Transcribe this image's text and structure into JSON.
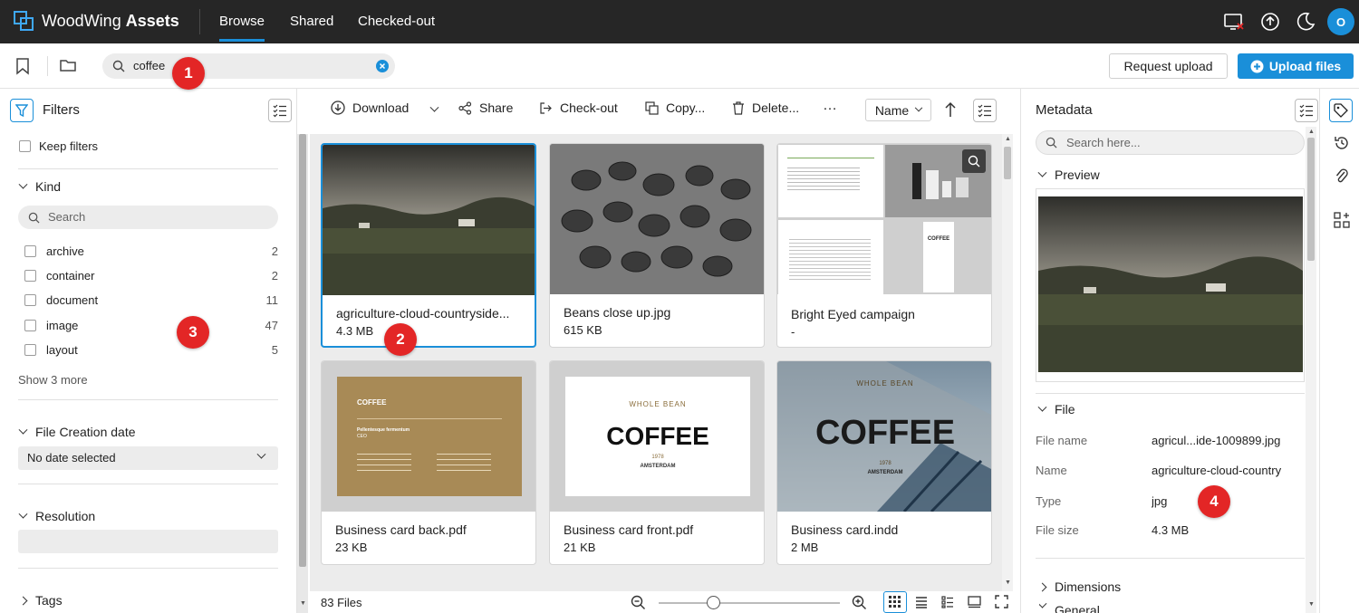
{
  "app": {
    "logo_text": "WoodWing",
    "logo_bold": "Assets",
    "avatar_initial": "O"
  },
  "nav": {
    "tabs": [
      "Browse",
      "Shared",
      "Checked-out"
    ],
    "active_tab": "Browse"
  },
  "toolbar": {
    "search_query": "coffee",
    "request_upload": "Request upload",
    "upload_files": "Upload files"
  },
  "filters": {
    "title": "Filters",
    "keep_filters": "Keep filters",
    "kind": {
      "title": "Kind",
      "search_placeholder": "Search",
      "items": [
        {
          "label": "archive",
          "count": "2"
        },
        {
          "label": "container",
          "count": "2"
        },
        {
          "label": "document",
          "count": "11"
        },
        {
          "label": "image",
          "count": "47"
        },
        {
          "label": "layout",
          "count": "5"
        }
      ],
      "show_more": "Show 3 more"
    },
    "file_creation_date": {
      "title": "File Creation date",
      "value": "No date selected"
    },
    "resolution": {
      "title": "Resolution"
    },
    "tags": {
      "title": "Tags"
    }
  },
  "actions": {
    "download": "Download",
    "share": "Share",
    "checkout": "Check-out",
    "copy": "Copy...",
    "delete": "Delete...",
    "more": "…",
    "sort": "Name"
  },
  "assets": [
    {
      "name": "agriculture-cloud-countryside...",
      "size": "4.3 MB"
    },
    {
      "name": "Beans close up.jpg",
      "size": "615 KB"
    },
    {
      "name": "Bright Eyed campaign",
      "size": "-"
    },
    {
      "name": "Business card back.pdf",
      "size": "23 KB"
    },
    {
      "name": "Business card front.pdf",
      "size": "21 KB"
    },
    {
      "name": "Business card.indd",
      "size": "2 MB"
    }
  ],
  "thumb_text": {
    "coffee": "COFFEE",
    "whole_bean": "WHOLE BEAN",
    "amsterdam": "AMSTERDAM",
    "est": "1978",
    "card_name": "Pellentesque fermentum",
    "card_role": "CEO"
  },
  "status": {
    "file_count": "83 Files",
    "zoom_level": 0.3
  },
  "metadata": {
    "title": "Metadata",
    "search_placeholder": "Search here...",
    "preview": "Preview",
    "file_section": "File",
    "fields": [
      {
        "label": "File name",
        "value": "agricul...ide-1009899.jpg"
      },
      {
        "label": "Name",
        "value": "agriculture-cloud-country"
      },
      {
        "label": "Type",
        "value": "jpg"
      },
      {
        "label": "File size",
        "value": "4.3 MB"
      }
    ],
    "dimensions": "Dimensions",
    "general": "General"
  },
  "badges": [
    "1",
    "2",
    "3",
    "4"
  ],
  "colors": {
    "accent": "#1a8fd9",
    "topbar": "#262626",
    "badge": "#e32626"
  }
}
